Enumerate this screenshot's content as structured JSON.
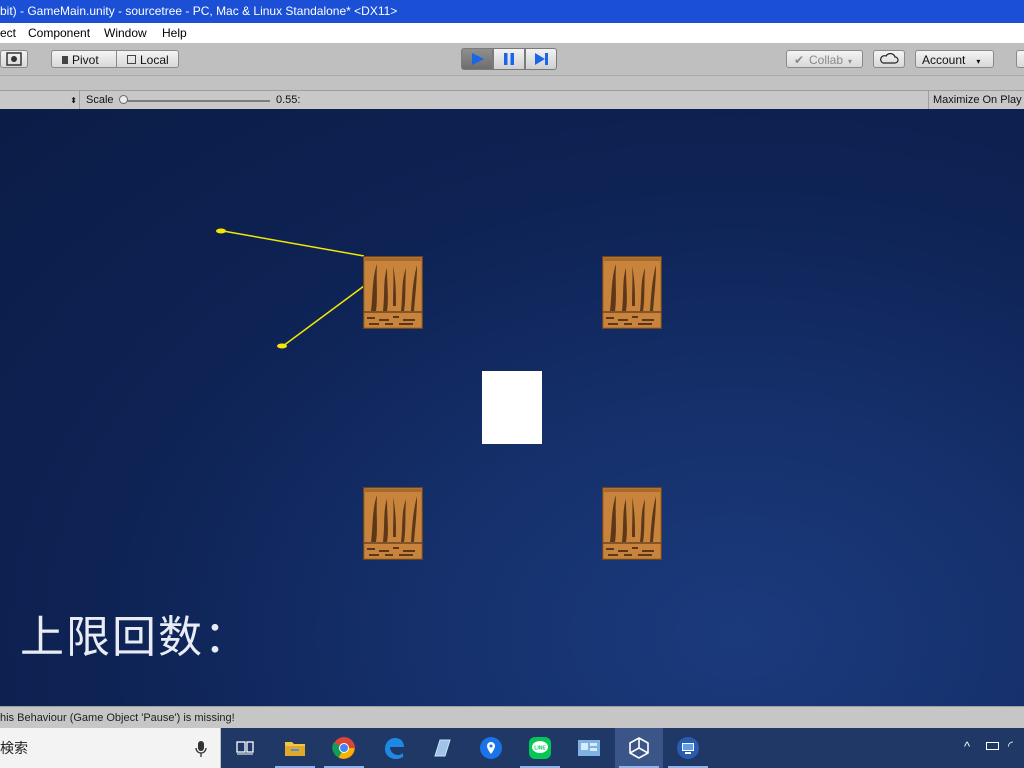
{
  "window": {
    "title": "bit) - GameMain.unity - sourcetree - PC, Mac & Linux Standalone* <DX11>"
  },
  "menu": {
    "items": [
      "ect",
      "Component",
      "Window",
      "Help"
    ]
  },
  "toolbar": {
    "pivot_label": "Pivot",
    "local_label": "Local",
    "collab_label": "Collab",
    "account_label": "Account"
  },
  "game_header": {
    "scale_label": "Scale",
    "scale_value": "0.55:",
    "scale_fraction": 0.0,
    "maximize_label": "Maximize On Play"
  },
  "game": {
    "limit_label": "上限回数："
  },
  "console": {
    "message": "his Behaviour (Game Object 'Pause') is missing!"
  },
  "taskbar": {
    "search_text": "検索",
    "apps": [
      "task-view",
      "file-explorer",
      "chrome",
      "edge",
      "app-generic",
      "maps",
      "line",
      "app-photos",
      "unity",
      "remote-desktop"
    ],
    "active_app": "unity"
  },
  "colors": {
    "title_bar": "#1a4fd6",
    "game_bg": "#0e2355",
    "crate": "#c8843c",
    "line": "#f5e800",
    "taskbar": "#1f3866"
  }
}
